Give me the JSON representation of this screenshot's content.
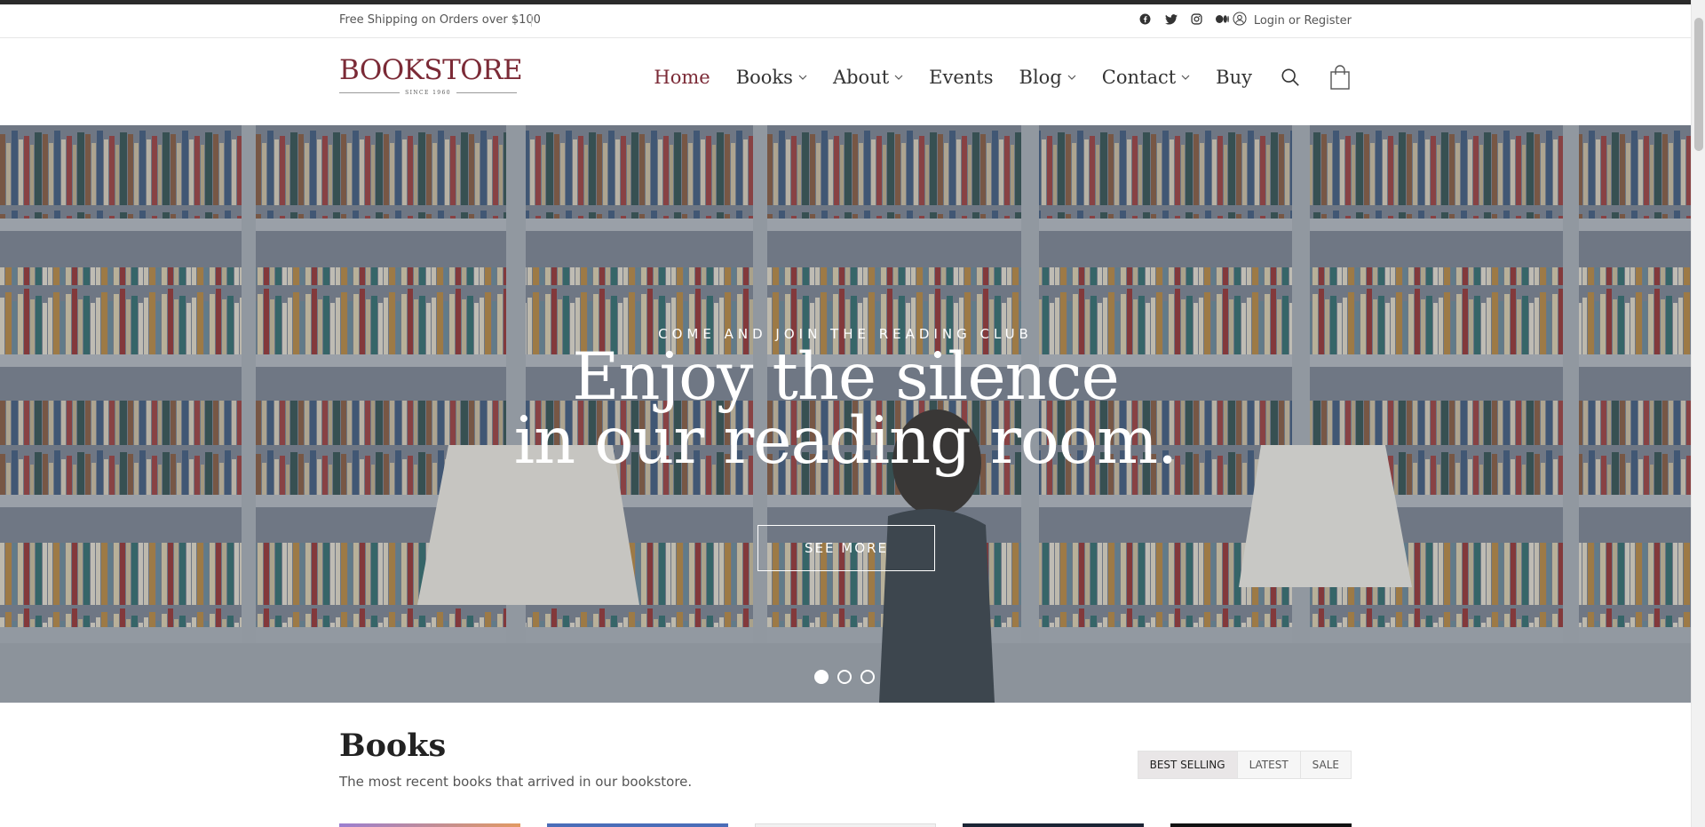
{
  "topbar": {
    "shipping_text": "Free Shipping on Orders over $100",
    "socials": [
      "facebook-icon",
      "twitter-icon",
      "instagram-icon",
      "medium-icon"
    ],
    "login_text": "Login or Register"
  },
  "header": {
    "logo_text": "BOOKSTORE",
    "logo_since": "SINCE 1960",
    "nav": [
      {
        "label": "Home",
        "active": true
      },
      {
        "label": "Books",
        "dropdown": true
      },
      {
        "label": "About",
        "dropdown": true
      },
      {
        "label": "Events"
      },
      {
        "label": "Blog",
        "dropdown": true
      },
      {
        "label": "Contact",
        "dropdown": true
      },
      {
        "label": "Buy"
      }
    ],
    "icons": [
      "search-icon",
      "shopping-bag-icon"
    ]
  },
  "hero": {
    "kicker": "COME AND JOIN THE READING CLUB",
    "title_line1": "Enjoy the silence",
    "title_line2": "in our reading room.",
    "button": "SEE MORE",
    "slide_count": 3,
    "active_slide": 1
  },
  "books": {
    "title": "Books",
    "subtitle": "The most recent books that arrived in our bookstore.",
    "tabs": [
      "BEST SELLING",
      "LATEST",
      "SALE"
    ]
  },
  "colors": {
    "brand": "#7b2a36",
    "topstrip": "#2b2b2b"
  }
}
